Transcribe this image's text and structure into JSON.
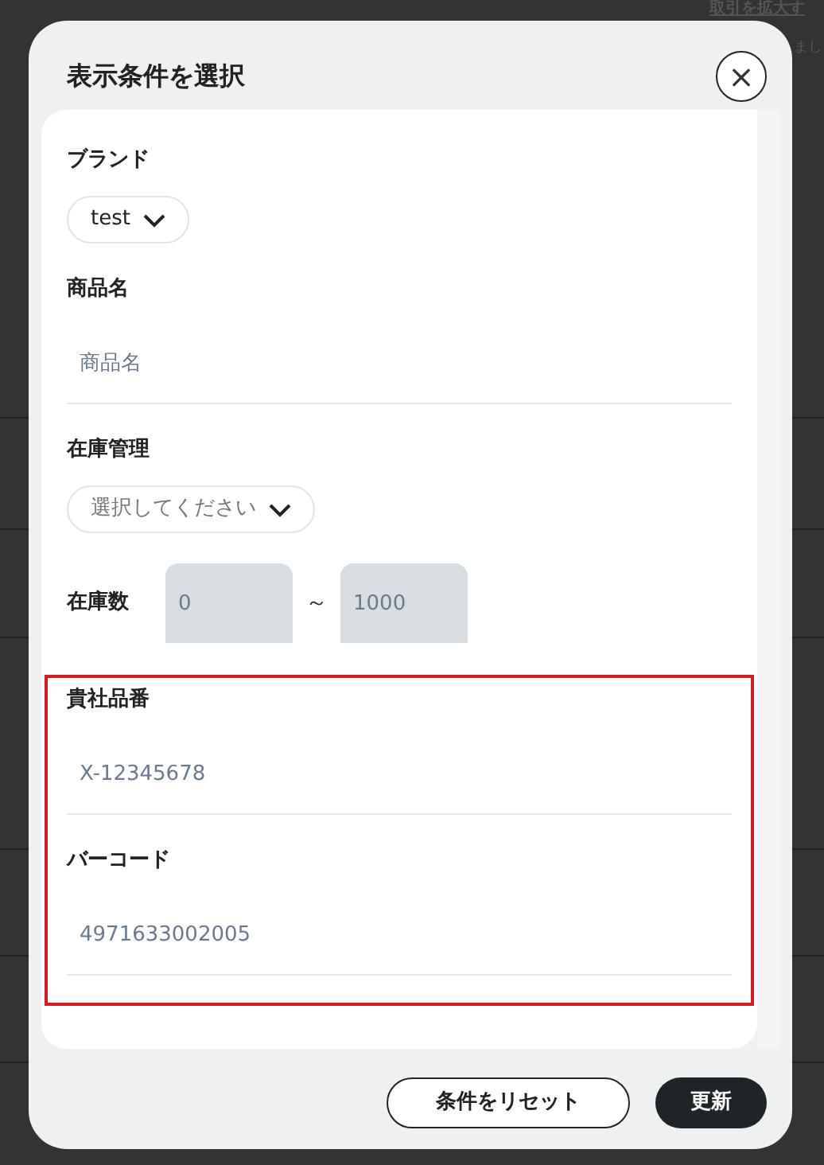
{
  "background_notice": {
    "lines": [
      "取引を拡大す",
      "まし"
    ]
  },
  "dialog": {
    "title": "表示条件を選択",
    "close_label": "×",
    "fields": [
      {
        "kind": "select",
        "label": "ブランド",
        "value": "test",
        "highlighted": false
      },
      {
        "kind": "text",
        "label": "商品名",
        "placeholder": "商品名",
        "highlighted": false
      },
      {
        "kind": "select",
        "label": "在庫管理",
        "placeholder": "選択してください",
        "highlighted": false
      },
      {
        "kind": "range",
        "label": "在庫数",
        "min_placeholder": "0",
        "separator": "～",
        "max_placeholder": "1000",
        "highlighted": false
      },
      {
        "kind": "text",
        "label": "貴社品番",
        "placeholder": "X-12345678",
        "highlighted": true
      },
      {
        "kind": "text",
        "label": "バーコード",
        "placeholder": "4971633002005",
        "highlighted": true
      }
    ],
    "buttons": [
      {
        "kind": "secondary",
        "label": "条件をリセット"
      },
      {
        "kind": "primary",
        "label": "更新"
      }
    ]
  }
}
